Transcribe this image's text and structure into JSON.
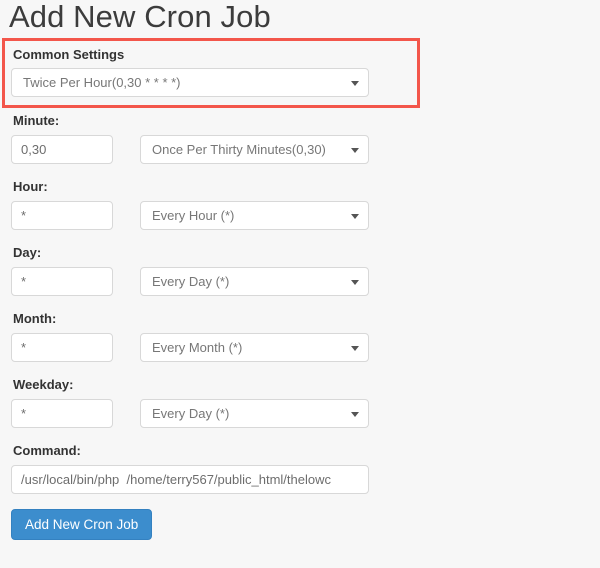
{
  "page": {
    "title": "Add New Cron Job"
  },
  "annotation": {
    "highlight_color": "#f3564b",
    "name": "common-settings-highlight"
  },
  "common_settings": {
    "label": "Common Settings",
    "select": {
      "value": "Twice Per Hour(0,30 * * * *)",
      "caret": "chevron-down-icon"
    }
  },
  "fields": [
    {
      "key": "minute",
      "label": "Minute:",
      "input_value": "0,30",
      "input_placeholder": "",
      "select_value": "Once Per Thirty Minutes(0,30)"
    },
    {
      "key": "hour",
      "label": "Hour:",
      "input_value": "*",
      "input_placeholder": "",
      "select_value": "Every Hour (*)"
    },
    {
      "key": "day",
      "label": "Day:",
      "input_value": "*",
      "input_placeholder": "",
      "select_value": "Every Day (*)"
    },
    {
      "key": "month",
      "label": "Month:",
      "input_value": "*",
      "input_placeholder": "",
      "select_value": "Every Month (*)"
    },
    {
      "key": "weekday",
      "label": "Weekday:",
      "input_value": "*",
      "input_placeholder": "",
      "select_value": "Every Day (*)"
    }
  ],
  "command": {
    "label": "Command:",
    "value": "/usr/local/bin/php  /home/terry567/public_html/thelowc",
    "placeholder": ""
  },
  "submit": {
    "label": "Add New Cron Job",
    "color": "#3c8dcd"
  },
  "colors": {
    "background": "#f7f7f7",
    "text": "#333333",
    "field_border": "#d8d8d8",
    "accent": "#3c8dcd",
    "highlight": "#f3564b"
  }
}
